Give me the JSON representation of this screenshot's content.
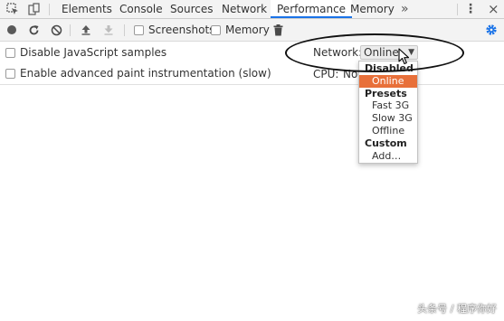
{
  "tabs": [
    {
      "label": "Elements"
    },
    {
      "label": "Console"
    },
    {
      "label": "Sources"
    },
    {
      "label": "Network"
    },
    {
      "label": "Performance",
      "active": true
    },
    {
      "label": "Memory"
    }
  ],
  "overflow_glyph": "»",
  "kebab_glyph": "⋮",
  "close_glyph": "×",
  "toolbar": {
    "screenshots_label": "Screenshots",
    "screenshots_checked": false,
    "memory_label": "Memory",
    "memory_checked": false,
    "icons": [
      "record-icon",
      "reload-icon",
      "clear-icon",
      "upload-icon",
      "download-icon",
      "trash-icon",
      "gear-icon"
    ]
  },
  "settings": {
    "disable_js_samples_label": "Disable JavaScript samples",
    "disable_js_samples_checked": false,
    "advanced_paint_label": "Enable advanced paint instrumentation (slow)",
    "advanced_paint_checked": false,
    "network_label": "Network:",
    "network_value": "Online",
    "cpu_label": "CPU:",
    "cpu_value": "No"
  },
  "network_dropdown": {
    "groups": [
      {
        "header": "Disabled",
        "options": [
          {
            "label": "Online",
            "selected": true
          }
        ]
      },
      {
        "header": "Presets",
        "options": [
          {
            "label": "Fast 3G"
          },
          {
            "label": "Slow 3G"
          },
          {
            "label": "Offline"
          }
        ]
      },
      {
        "header": "Custom",
        "options": [
          {
            "label": "Add…"
          }
        ]
      }
    ]
  },
  "colors": {
    "accent": "#1a73e8",
    "selected_option": "#e8703a",
    "toolbar_bg": "#f3f3f3"
  },
  "watermark": "头条号 / 程序你好"
}
